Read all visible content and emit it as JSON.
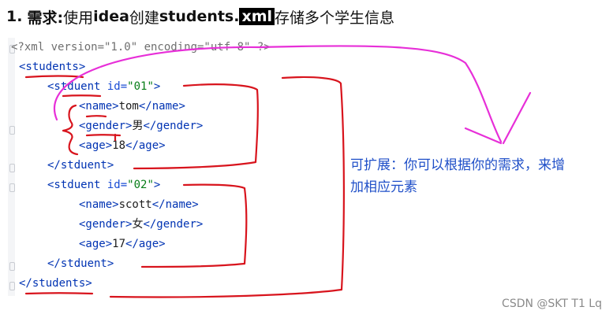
{
  "heading": {
    "number": "1.",
    "label": "需求:",
    "text1": "使用",
    "bold1": "idea",
    "text2": "创建",
    "bold2": "students.",
    "highlight": "xml",
    "text3": "存储多个学生信息"
  },
  "code": {
    "lines": [
      {
        "parts": [
          [
            "pi",
            "<?xml version=\"1.0\" encoding=\"utf-8\" ?>"
          ]
        ]
      },
      {
        "parts": [
          [
            "tag",
            "<students>"
          ]
        ]
      },
      {
        "parts": [
          [
            "tag",
            "<stduent "
          ],
          [
            "attr",
            "id="
          ],
          [
            "str",
            "\"01\""
          ],
          [
            "tag",
            ">"
          ]
        ]
      },
      {
        "parts": [
          [
            "tag",
            "<name>"
          ],
          [
            "text",
            "tom"
          ],
          [
            "tag",
            "</name>"
          ]
        ]
      },
      {
        "parts": [
          [
            "tag",
            "<gender>"
          ],
          [
            "text",
            "男"
          ],
          [
            "tag",
            "</gender>"
          ]
        ]
      },
      {
        "parts": [
          [
            "tag",
            "<age>"
          ],
          [
            "text",
            "18"
          ],
          [
            "tag",
            "</age>"
          ]
        ]
      },
      {
        "parts": [
          [
            "tag",
            "</stduent>"
          ]
        ]
      },
      {
        "parts": [
          [
            "tag",
            "<stduent "
          ],
          [
            "attr",
            "id="
          ],
          [
            "str",
            "\"02\""
          ],
          [
            "tag",
            ">"
          ]
        ]
      },
      {
        "parts": [
          [
            "tag",
            "<name>"
          ],
          [
            "text",
            "scott"
          ],
          [
            "tag",
            "</name>"
          ]
        ]
      },
      {
        "parts": [
          [
            "tag",
            "<gender>"
          ],
          [
            "text",
            "女"
          ],
          [
            "tag",
            "</gender>"
          ]
        ]
      },
      {
        "parts": [
          [
            "tag",
            "<age>"
          ],
          [
            "text",
            "17"
          ],
          [
            "tag",
            "</age>"
          ]
        ]
      },
      {
        "parts": [
          [
            "tag",
            "</stduent>"
          ]
        ]
      },
      {
        "parts": [
          [
            "tag",
            "</students>"
          ]
        ]
      }
    ]
  },
  "note": {
    "line1": "可扩展：你可以根据你的需求，来增",
    "line2": "加相应元素"
  },
  "watermark": "CSDN @SKT T1 Lq",
  "colors": {
    "annotation_red": "#d8141d",
    "annotation_magenta": "#e72fd8",
    "note_blue": "#1f4fc8"
  }
}
